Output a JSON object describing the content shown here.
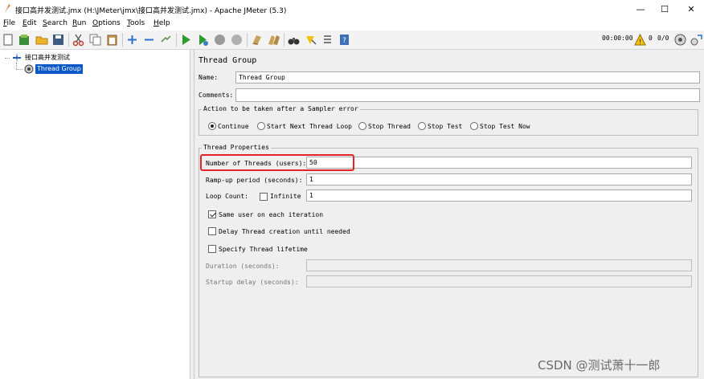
{
  "window": {
    "title": "接口高并发测试.jmx (H:\\JMeter\\jmx\\接口高并发测试.jmx) - Apache JMeter (5.3)",
    "minimize": "—",
    "maximize": "☐",
    "close": "✕"
  },
  "menu": [
    "File",
    "Edit",
    "Search",
    "Run",
    "Options",
    "Tools",
    "Help"
  ],
  "toolbar": {
    "timer": "00:00:00",
    "warning_count": "0",
    "thread_count": "0/0"
  },
  "tree": {
    "root": "接口高并发测试",
    "child": "Thread Group"
  },
  "panel": {
    "heading": "Thread Group",
    "name_label": "Name:",
    "name_value": "Thread Group",
    "comments_label": "Comments:",
    "comments_value": "",
    "sampler_error": {
      "legend": "Action to be taken after a Sampler error",
      "options": [
        "Continue",
        "Start Next Thread Loop",
        "Stop Thread",
        "Stop Test",
        "Stop Test Now"
      ],
      "selected": "Continue"
    },
    "thread_props": {
      "legend": "Thread Properties",
      "threads_label": "Number of Threads (users):",
      "threads_value": "50",
      "rampup_label": "Ramp-up period (seconds):",
      "rampup_value": "1",
      "loop_label": "Loop Count:",
      "infinite_label": "Infinite",
      "loop_value": "1",
      "same_user_label": "Same user on each iteration",
      "delay_label": "Delay Thread creation until needed",
      "lifetime_label": "Specify Thread lifetime",
      "duration_label": "Duration (seconds):",
      "startup_label": "Startup delay (seconds):"
    }
  },
  "watermark": "CSDN @测试萧十一郎",
  "colors": {
    "selection": "#0a58c7",
    "highlight_box": "#e2242a"
  }
}
